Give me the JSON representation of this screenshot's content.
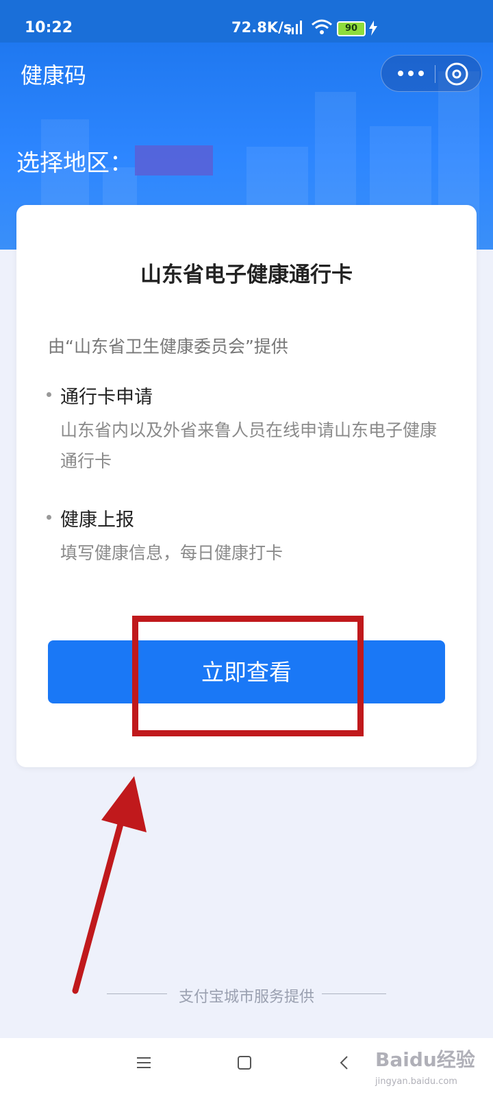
{
  "status_bar": {
    "time": "10:22",
    "net_speed": "72.8K/s",
    "battery": "90"
  },
  "header": {
    "title": "健康码",
    "more_icon": "more-dots-icon",
    "close_icon": "close-circle-icon"
  },
  "region": {
    "label": "选择地区："
  },
  "card": {
    "title": "山东省电子健康通行卡",
    "provider": "由“山东省卫生健康委员会”提供",
    "features": [
      {
        "title": "通行卡申请",
        "desc": "山东省内以及外省来鲁人员在线申请山东电子健康通行卡"
      },
      {
        "title": "健康上报",
        "desc": "填写健康信息，每日健康打卡"
      }
    ],
    "button_label": "立即查看"
  },
  "footer": {
    "credit": "支付宝城市服务提供"
  },
  "nav": {
    "menu_icon": "menu-icon",
    "home_icon": "home-square-icon",
    "back_icon": "back-chevron-icon"
  },
  "watermark": {
    "text": "Baidu经验",
    "subtext": "jingyan.baidu.com"
  },
  "colors": {
    "primary": "#1a78f6",
    "annotation_red": "#c0191c"
  }
}
